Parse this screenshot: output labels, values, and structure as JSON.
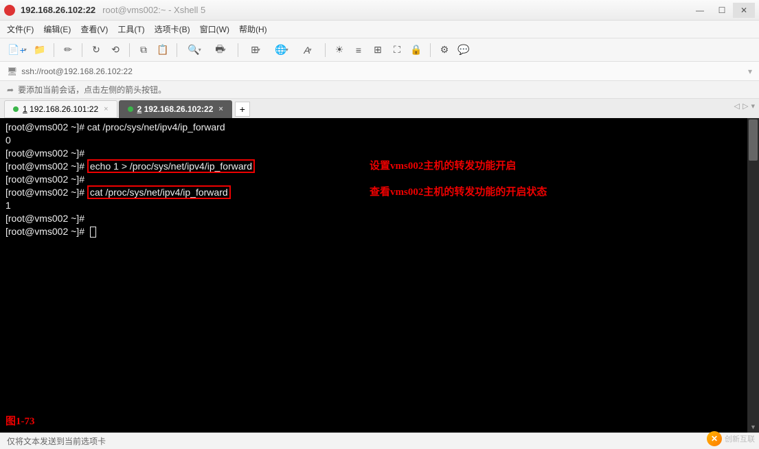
{
  "window": {
    "title_main": "192.168.26.102:22",
    "title_sub": "root@vms002:~ - Xshell 5"
  },
  "menu": {
    "file": "文件(F)",
    "edit": "编辑(E)",
    "view": "查看(V)",
    "tools": "工具(T)",
    "tabs": "选项卡(B)",
    "window": "窗口(W)",
    "help": "帮助(H)"
  },
  "address": {
    "url": "ssh://root@192.168.26.102:22"
  },
  "hint": {
    "text": "要添加当前会话，点击左侧的箭头按钮。"
  },
  "tabs": {
    "items": [
      {
        "num": "1",
        "label": "192.168.26.101:22",
        "active": false
      },
      {
        "num": "2",
        "label": "192.168.26.102:22",
        "active": true
      }
    ],
    "add": "+"
  },
  "terminal": {
    "lines": [
      {
        "prompt": "[root@vms002 ~]# ",
        "cmd": "cat /proc/sys/net/ipv4/ip_forward",
        "hl": false
      },
      {
        "prompt": "",
        "cmd": "0",
        "hl": false
      },
      {
        "prompt": "[root@vms002 ~]# ",
        "cmd": "",
        "hl": false
      },
      {
        "prompt": "[root@vms002 ~]# ",
        "cmd": "echo 1 > /proc/sys/net/ipv4/ip_forward",
        "hl": true,
        "ann": "设置vms002主机的转发功能开启"
      },
      {
        "prompt": "[root@vms002 ~]# ",
        "cmd": "",
        "hl": false
      },
      {
        "prompt": "[root@vms002 ~]# ",
        "cmd": "cat /proc/sys/net/ipv4/ip_forward",
        "hl": true,
        "ann": "查看vms002主机的转发功能的开启状态"
      },
      {
        "prompt": "",
        "cmd": "1",
        "hl": false
      },
      {
        "prompt": "[root@vms002 ~]# ",
        "cmd": "",
        "hl": false
      },
      {
        "prompt": "[root@vms002 ~]# ",
        "cmd": "",
        "hl": false,
        "cursor": true
      }
    ],
    "figure": "图1-73"
  },
  "status": {
    "text": "仅将文本发送到当前选项卡"
  },
  "watermark": {
    "text": "创新互联"
  },
  "icons": {
    "new": "📄",
    "folder": "📁",
    "pencil": "✏",
    "copy": "⧉",
    "paste": "📋",
    "search": "🔍",
    "printer": "🖶",
    "layout": "⊞",
    "globe": "🌐",
    "font": "A",
    "bold": "☀",
    "cols": "≡",
    "grid": "⊞",
    "expand": "⛶",
    "lock": "🔒",
    "gear": "⚙",
    "chat": "💬"
  }
}
